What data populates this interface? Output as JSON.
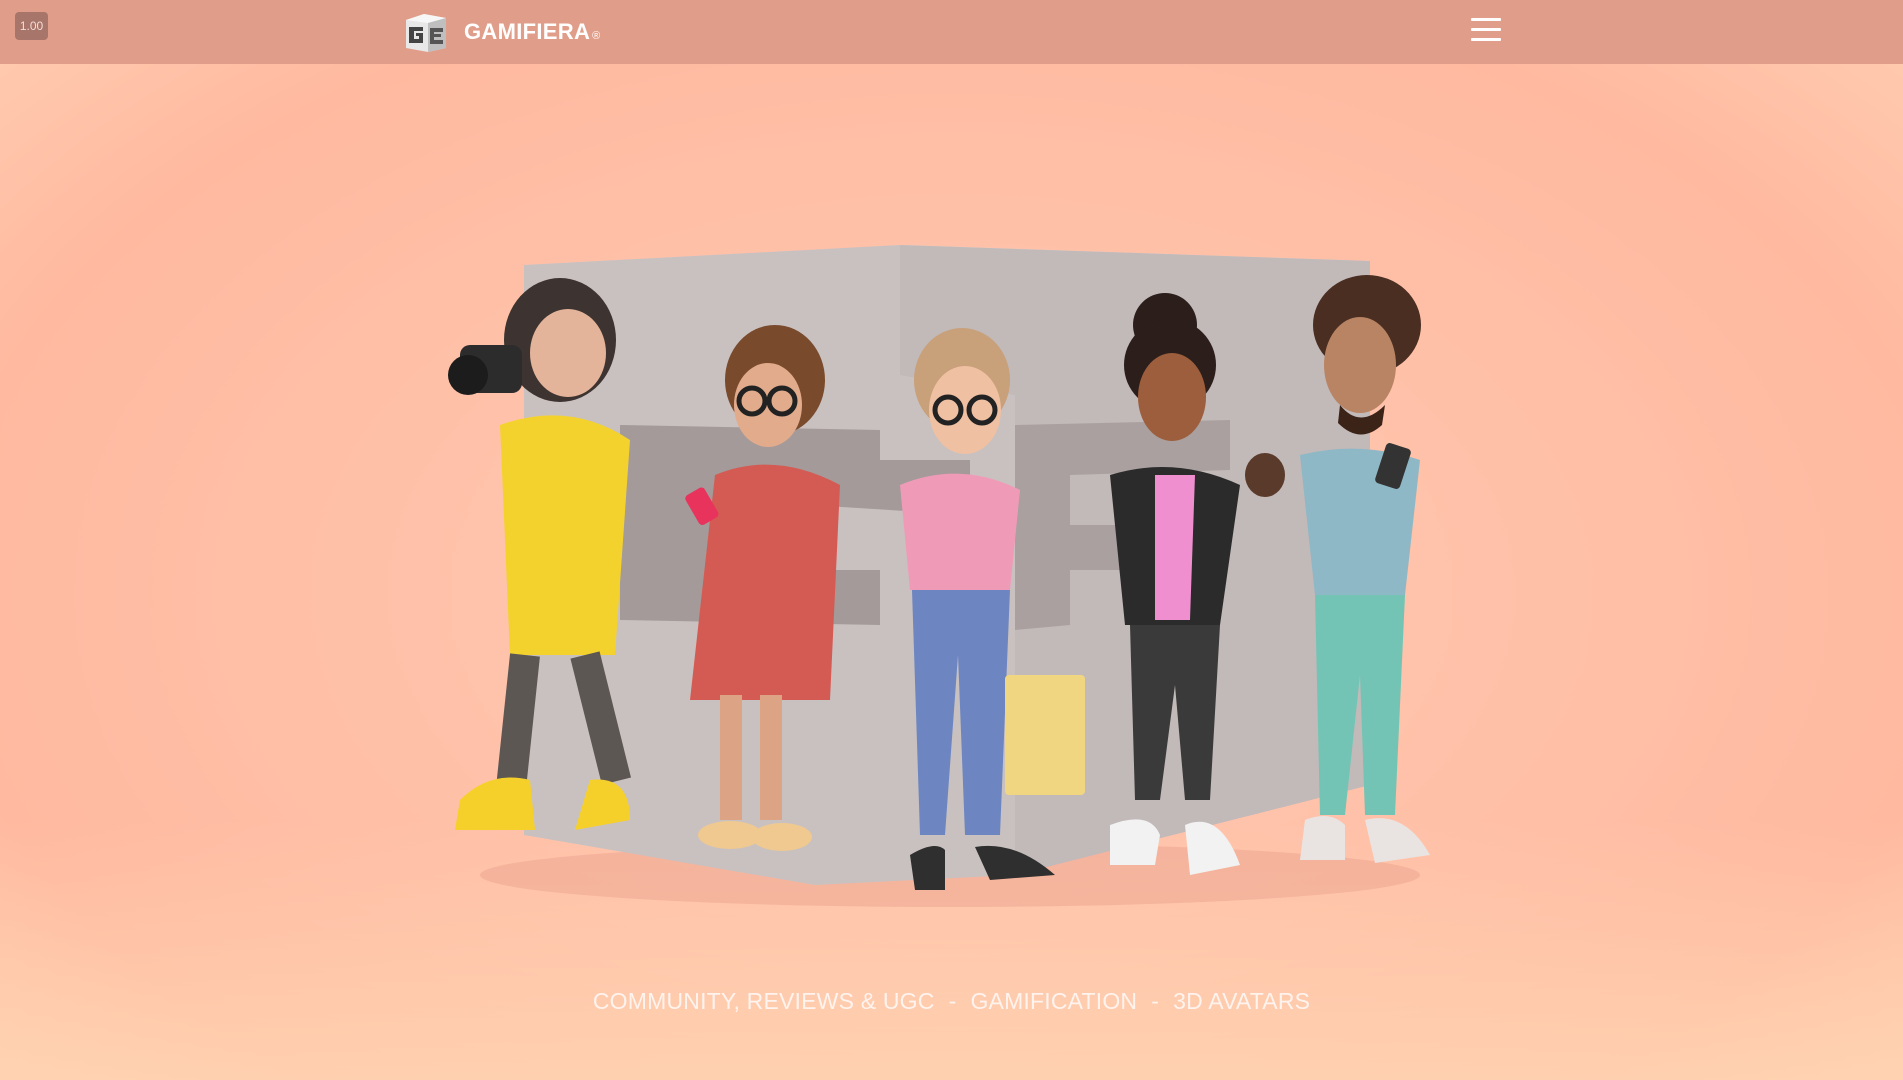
{
  "zoom_badge": "1.00",
  "header": {
    "brand_name": "GAMIFIERA",
    "brand_reg": "®",
    "logo_icon": "gamifiera-cube-logo",
    "menu_icon": "hamburger-menu-icon"
  },
  "hero": {
    "illustration": "3d-avatars-with-cube",
    "tagline": {
      "item1": "COMMUNITY, REVIEWS & UGC",
      "sep1": "-",
      "item2": "GAMIFICATION",
      "sep2": "-",
      "item3": "3D AVATARS"
    }
  },
  "colors": {
    "topbar": "#e09e8a",
    "background": "#ffc2aa",
    "text": "#ffffff"
  }
}
